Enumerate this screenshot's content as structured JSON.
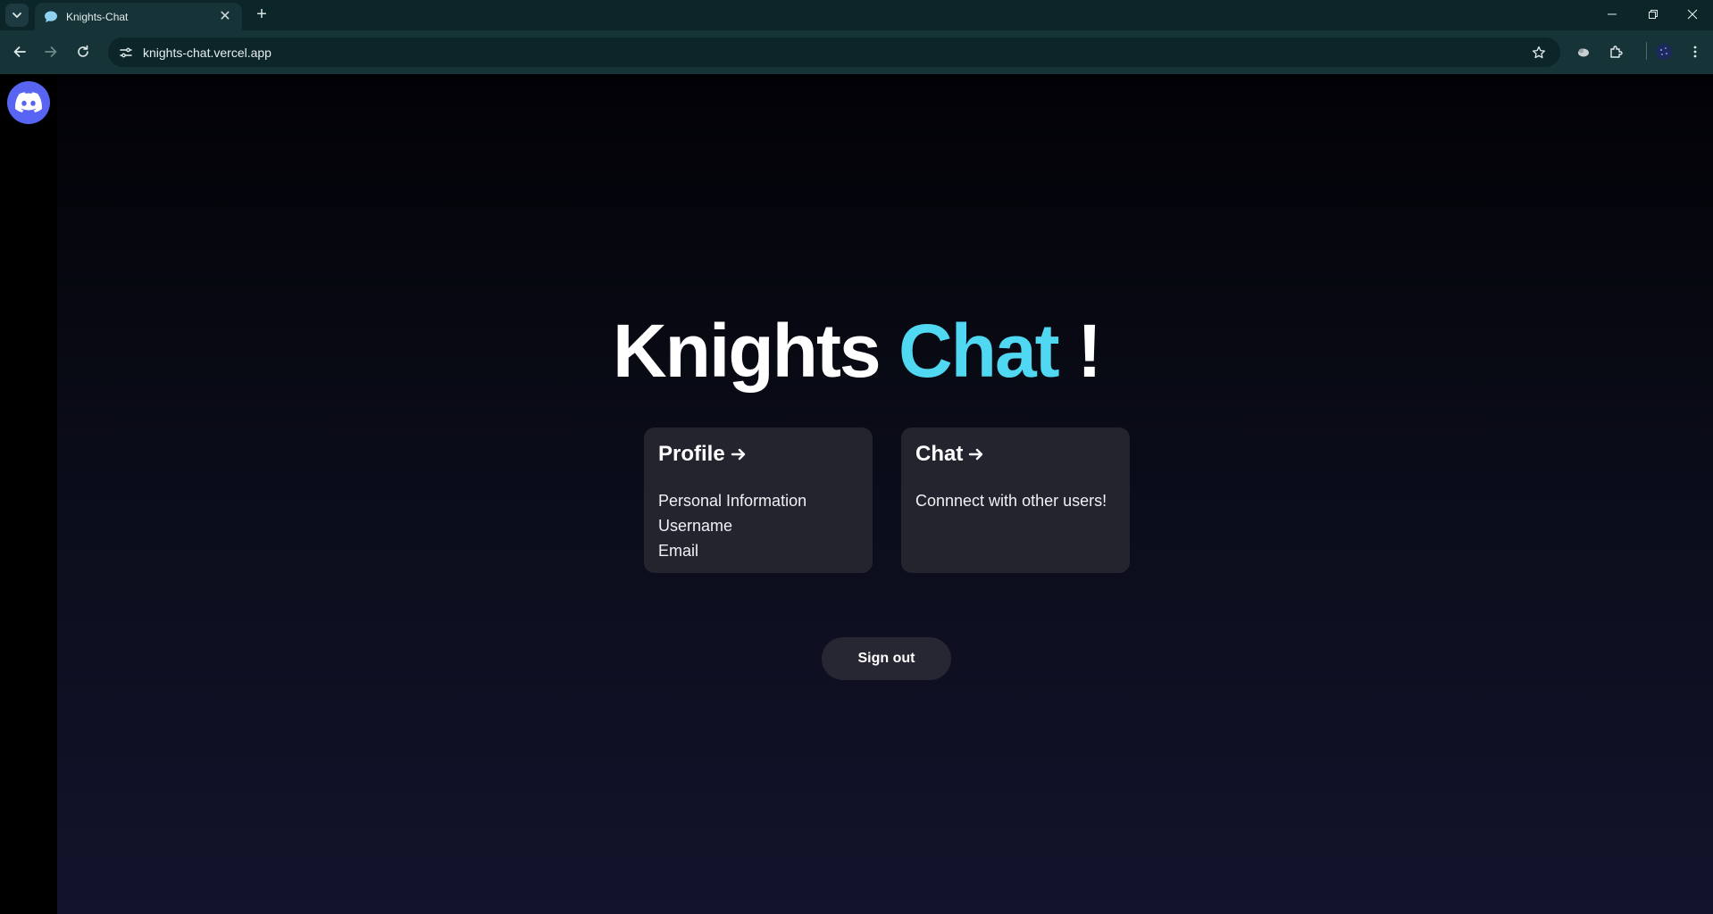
{
  "browser": {
    "tab": {
      "title": "Knights-Chat",
      "favicon_icon": "speech-bubble-icon",
      "close_glyph": "✕"
    },
    "new_tab_glyph": "+",
    "address_bar": {
      "url": "knights-chat.vercel.app"
    }
  },
  "page": {
    "headline": {
      "part1": "Knights ",
      "part2": "Chat",
      "part3": " !"
    },
    "accent_color": "#50d8f2",
    "cards": [
      {
        "title": "Profile",
        "lines": [
          "Personal Information",
          "Username",
          "Email"
        ]
      },
      {
        "title": "Chat",
        "lines": [
          "Connnect with other users!"
        ]
      }
    ],
    "signout_label": "Sign out",
    "discord_color": "#5865f2"
  }
}
